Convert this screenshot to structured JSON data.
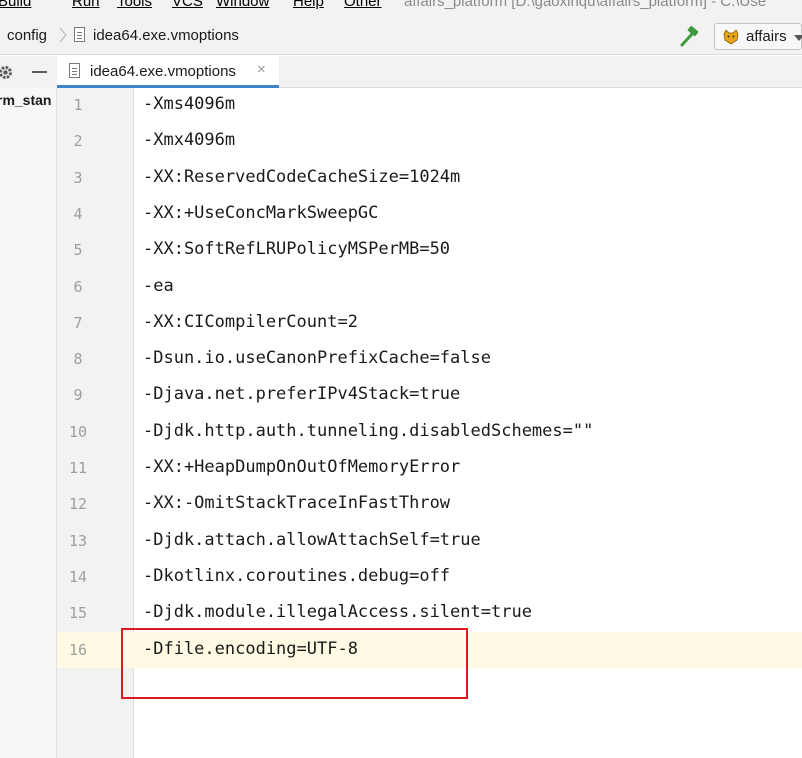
{
  "menubar": {
    "items": [
      "Build",
      "Run",
      "Tools",
      "VCS",
      "Window",
      "Help",
      "Other"
    ],
    "window_title": "affairs_platform [D:\\gaoxinqu\\affairs_platform] - C:\\Use"
  },
  "navbar": {
    "breadcrumbs": [
      "config",
      "idea64.exe.vmoptions"
    ],
    "run_config_label": "affairs"
  },
  "project_panel": {
    "tree_item": "rm_stan"
  },
  "tabs": [
    {
      "label": "idea64.exe.vmoptions",
      "close": "×"
    }
  ],
  "editor": {
    "lines": [
      {
        "num": "1",
        "code": "-Xms4096m"
      },
      {
        "num": "2",
        "code": "-Xmx4096m"
      },
      {
        "num": "3",
        "code": "-XX:ReservedCodeCacheSize=1024m"
      },
      {
        "num": "4",
        "code": "-XX:+UseConcMarkSweepGC"
      },
      {
        "num": "5",
        "code": "-XX:SoftRefLRUPolicyMSPerMB=50"
      },
      {
        "num": "6",
        "code": "-ea"
      },
      {
        "num": "7",
        "code": "-XX:CICompilerCount=2"
      },
      {
        "num": "8",
        "code": "-Dsun.io.useCanonPrefixCache=false"
      },
      {
        "num": "9",
        "code": "-Djava.net.preferIPv4Stack=true"
      },
      {
        "num": "10",
        "code": "-Djdk.http.auth.tunneling.disabledSchemes=\"\""
      },
      {
        "num": "11",
        "code": "-XX:+HeapDumpOnOutOfMemoryError"
      },
      {
        "num": "12",
        "code": "-XX:-OmitStackTraceInFastThrow"
      },
      {
        "num": "13",
        "code": "-Djdk.attach.allowAttachSelf=true"
      },
      {
        "num": "14",
        "code": "-Dkotlinx.coroutines.debug=off"
      },
      {
        "num": "15",
        "code": "-Djdk.module.illegalAccess.silent=true"
      },
      {
        "num": "16",
        "code": "-Dfile.encoding=UTF-8"
      }
    ]
  },
  "colors": {
    "highlight_box": "#e0191e",
    "current_line": "#fffae3",
    "tab_underline": "#4083c9"
  }
}
